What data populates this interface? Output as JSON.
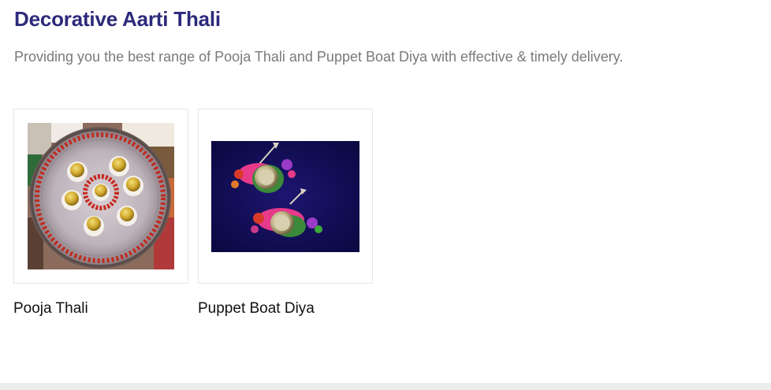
{
  "section": {
    "title": "Decorative Aarti Thali",
    "subtitle": "Providing you the best range of Pooja Thali and Puppet Boat Diya with effective & timely delivery."
  },
  "products": [
    {
      "name": "Pooja Thali",
      "image_icon": "pooja-thali-image"
    },
    {
      "name": "Puppet Boat Diya",
      "image_icon": "puppet-boat-diya-image"
    }
  ],
  "colors": {
    "title": "#2c2a7a",
    "subtitle": "#7a7a7a",
    "product_text": "#111111",
    "card_border": "#e6e6e6"
  }
}
